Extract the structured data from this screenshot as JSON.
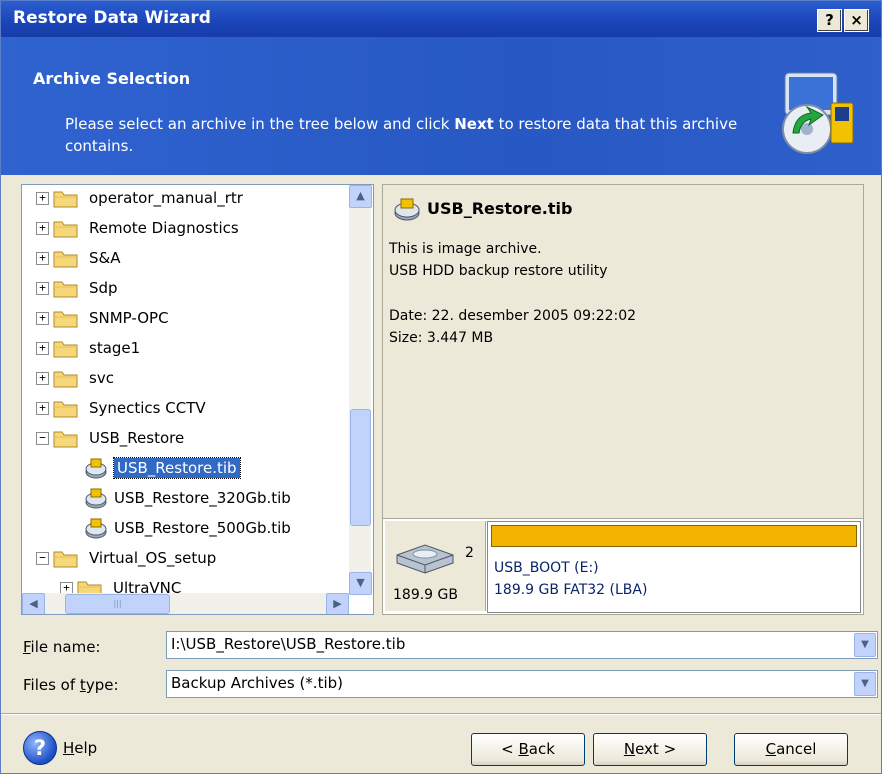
{
  "window": {
    "title": "Restore Data Wizard",
    "help_glyph": "?",
    "close_glyph": "×"
  },
  "header": {
    "title": "Archive Selection",
    "desc_before": "Please select an archive in the tree below and click ",
    "desc_bold": "Next",
    "desc_after": " to restore data that this archive contains.",
    "icon": "wizard-restore-icon"
  },
  "tree": {
    "items": [
      {
        "label": "operator_manual_rtr",
        "kind": "folder",
        "expander": "+",
        "indent": 0
      },
      {
        "label": "Remote Diagnostics",
        "kind": "folder",
        "expander": "+",
        "indent": 0
      },
      {
        "label": "S&A",
        "kind": "folder",
        "expander": "+",
        "indent": 0
      },
      {
        "label": "Sdp",
        "kind": "folder",
        "expander": "+",
        "indent": 0
      },
      {
        "label": "SNMP-OPC",
        "kind": "folder",
        "expander": "+",
        "indent": 0
      },
      {
        "label": "stage1",
        "kind": "folder",
        "expander": "+",
        "indent": 0
      },
      {
        "label": "svc",
        "kind": "folder",
        "expander": "+",
        "indent": 0
      },
      {
        "label": "Synectics CCTV",
        "kind": "folder",
        "expander": "+",
        "indent": 0
      },
      {
        "label": "USB_Restore",
        "kind": "folder",
        "expander": "−",
        "indent": 0
      },
      {
        "label": "USB_Restore.tib",
        "kind": "file",
        "selected": true,
        "indent": 1
      },
      {
        "label": "USB_Restore_320Gb.tib",
        "kind": "file",
        "indent": 1
      },
      {
        "label": "USB_Restore_500Gb.tib",
        "kind": "file",
        "indent": 1
      },
      {
        "label": "Virtual_OS_setup",
        "kind": "folder",
        "expander": "−",
        "indent": 0
      },
      {
        "label": "UltraVNC",
        "kind": "folder",
        "expander": "+",
        "indent": 1
      }
    ]
  },
  "info": {
    "title": "USB_Restore.tib",
    "line1": "This is image archive.",
    "line2": "USB HDD backup restore utility",
    "date": "Date: 22. desember 2005 09:22:02",
    "size": "Size: 3.447 MB"
  },
  "disk": {
    "number": "2",
    "size": "189.9 GB",
    "partition_name": "USB_BOOT (E:)",
    "partition_info": "189.9 GB  FAT32 (LBA)",
    "partition_color": "#f2b300"
  },
  "fields": {
    "file_name_label_u": "F",
    "file_name_label_rest": "ile name:",
    "file_name_value": "I:\\USB_Restore\\USB_Restore.tib",
    "file_type_label_a": "Files of ",
    "file_type_label_u": "t",
    "file_type_label_b": "ype:",
    "file_type_value": "Backup Archives (*.tib)"
  },
  "buttons": {
    "help_u": "H",
    "help_rest": "elp",
    "back_pre": "< ",
    "back_u": "B",
    "back_rest": "ack",
    "next_u": "N",
    "next_rest": "ext >",
    "cancel_u": "C",
    "cancel_rest": "ancel"
  }
}
